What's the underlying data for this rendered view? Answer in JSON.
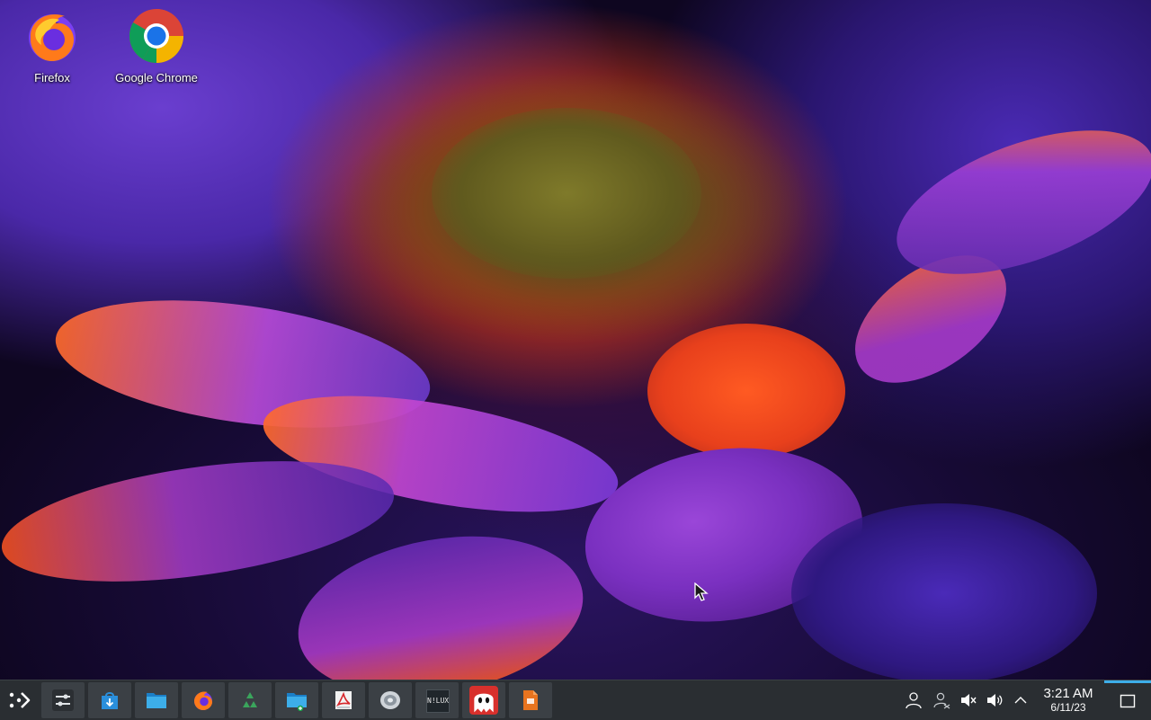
{
  "desktop": {
    "icons": [
      {
        "label": "Firefox",
        "icon": "firefox-icon"
      },
      {
        "label": "Google Chrome",
        "icon": "chrome-icon"
      }
    ],
    "wallpaper": "purple-orange-flower-wallpaper"
  },
  "taskbar": {
    "launcher_icon": "application-launcher-icon",
    "tasks": [
      {
        "name": "System Settings",
        "icon": "settings-sliders-icon"
      },
      {
        "name": "Discover",
        "icon": "software-store-icon"
      },
      {
        "name": "Dolphin",
        "icon": "folder-icon"
      },
      {
        "name": "Firefox",
        "icon": "firefox-icon"
      },
      {
        "name": "Recycle",
        "icon": "recycle-icon"
      },
      {
        "name": "File Manager Add",
        "icon": "folder-add-icon"
      },
      {
        "name": "Document Viewer",
        "icon": "pdf-document-icon"
      },
      {
        "name": "Disk Utility",
        "icon": "disk-icon"
      },
      {
        "name": "NILUX",
        "icon": "nilux-icon",
        "text": "N!LUX"
      },
      {
        "name": "Ghost",
        "icon": "ghost-icon"
      },
      {
        "name": "Presentation",
        "icon": "presentation-document-icon"
      }
    ],
    "tray": {
      "icons": [
        "user-icon",
        "user-status-icon",
        "audio-muted-icon",
        "volume-icon",
        "chevron-up-icon"
      ]
    },
    "clock": {
      "time": "3:21 AM",
      "date": "6/11/23"
    },
    "show_desktop_icon": "show-desktop-icon",
    "accent": "#3daee9"
  }
}
